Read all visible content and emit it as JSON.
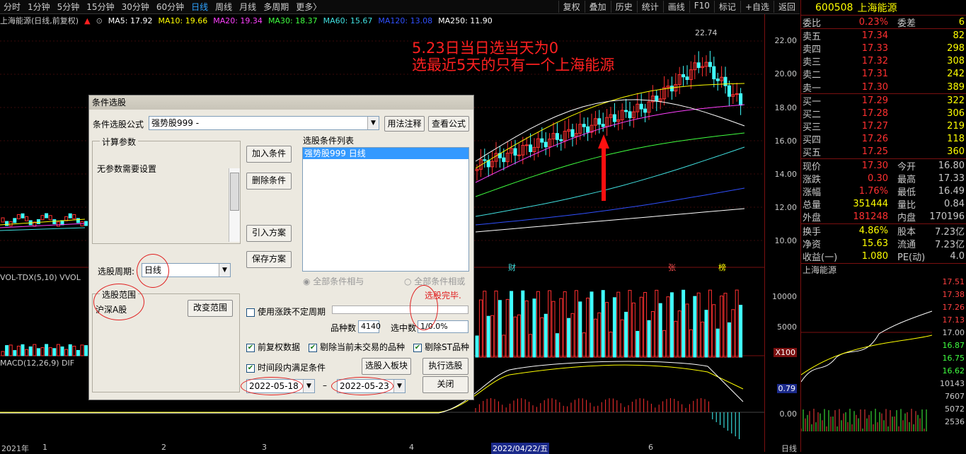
{
  "toolbar": {
    "tabs": [
      "分时",
      "1分钟",
      "5分钟",
      "15分钟",
      "30分钟",
      "60分钟",
      "日线",
      "周线",
      "月线",
      "多周期",
      "更多〉"
    ],
    "active_tab": "日线",
    "right_buttons": [
      "复权",
      "叠加",
      "历史",
      "统计",
      "画线",
      "F10",
      "标记",
      "+自选",
      "返回"
    ]
  },
  "ma_bar": {
    "title": "上海能源(日线,前复权)",
    "ma5": "MA5: 17.92",
    "ma10": "MA10: 19.66",
    "ma20": "MA20: 19.34",
    "ma30": "MA30: 18.37",
    "ma60": "MA60: 15.67",
    "ma120": "MA120: 13.08",
    "ma250": "MA250: 11.90"
  },
  "colors": {
    "ma5": "#ffffff",
    "ma10": "#ffff00",
    "ma20": "#ff40ff",
    "ma30": "#40ff40",
    "ma60": "#40e0e0",
    "ma120": "#3050ff",
    "ma250": "#ffffff",
    "up": "#ff3030",
    "down": "#40ffff"
  },
  "price_axis": [
    "22.00",
    "20.00",
    "18.00",
    "16.00",
    "14.00",
    "12.00",
    "10.00"
  ],
  "high_label": "22.74",
  "volume_axis": [
    "10000",
    "5000"
  ],
  "volume_unit": "X100",
  "macd_axis": [
    "0.79",
    "0.00"
  ],
  "panels": {
    "volume": "VOL-TDX(5,10) VVOL",
    "macd": "MACD(12,26,9) DIF"
  },
  "markers": {
    "cai": "财",
    "zhang": "张",
    "bang": "榜"
  },
  "date_axis": [
    "2021年",
    "1",
    "2",
    "3",
    "4",
    "2022/04/22/五",
    "6"
  ],
  "period_label": "日线",
  "annotation": {
    "line1": "5.23日当日选当天为0",
    "line2": "选最近5天的只有一个上海能源"
  },
  "quote": {
    "code": "600508",
    "name": "上海能源",
    "weibi_label": "委比",
    "weibi": "0.23%",
    "weicha_label": "委差",
    "weicha": "6",
    "asks": [
      {
        "label": "卖五",
        "price": "17.34",
        "vol": "82"
      },
      {
        "label": "卖四",
        "price": "17.33",
        "vol": "298"
      },
      {
        "label": "卖三",
        "price": "17.32",
        "vol": "308"
      },
      {
        "label": "卖二",
        "price": "17.31",
        "vol": "242"
      },
      {
        "label": "卖一",
        "price": "17.30",
        "vol": "389"
      }
    ],
    "bids": [
      {
        "label": "买一",
        "price": "17.29",
        "vol": "322"
      },
      {
        "label": "买二",
        "price": "17.28",
        "vol": "306"
      },
      {
        "label": "买三",
        "price": "17.27",
        "vol": "219"
      },
      {
        "label": "买四",
        "price": "17.26",
        "vol": "118"
      },
      {
        "label": "买五",
        "price": "17.25",
        "vol": "360"
      }
    ],
    "stats": [
      {
        "l1": "现价",
        "v1": "17.30",
        "l2": "今开",
        "v2": "16.80",
        "c1": "red",
        "c2": "red"
      },
      {
        "l1": "涨跌",
        "v1": "0.30",
        "l2": "最高",
        "v2": "17.33",
        "c1": "red",
        "c2": "red"
      },
      {
        "l1": "涨幅",
        "v1": "1.76%",
        "l2": "最低",
        "v2": "16.49",
        "c1": "red",
        "c2": "green"
      },
      {
        "l1": "总量",
        "v1": "351444",
        "l2": "量比",
        "v2": "0.84",
        "c1": "yellow",
        "c2": "yellow"
      },
      {
        "l1": "外盘",
        "v1": "181248",
        "l2": "内盘",
        "v2": "170196",
        "c1": "red",
        "c2": "green"
      }
    ],
    "stats2": [
      {
        "l1": "换手",
        "v1": "4.86%",
        "l2": "股本",
        "v2": "7.23亿"
      },
      {
        "l1": "净资",
        "v1": "15.63",
        "l2": "流通",
        "v2": "7.23亿"
      },
      {
        "l1": "收益(一)",
        "v1": "1.080",
        "l2": "PE(动)",
        "v2": "4.0"
      }
    ],
    "mini_title": "上海能源",
    "mini_axis": [
      "17.51",
      "17.38",
      "17.26",
      "17.13",
      "17.00",
      "16.87",
      "16.75",
      "16.62",
      "10143",
      "7607",
      "5072",
      "2536"
    ]
  },
  "dialog": {
    "title": "条件选股",
    "formula_label": "条件选股公式",
    "formula_value": "强势股999    -",
    "btn_usage": "用法注释",
    "btn_view": "查看公式",
    "params_group": "计算参数",
    "params_text": "无参数需要设置",
    "btn_add": "加入条件",
    "btn_delete": "删除条件",
    "btn_import": "引入方案",
    "btn_save": "保存方案",
    "list_label": "选股条件列表",
    "list_items": [
      "强势股999   日线"
    ],
    "period_label": "选股周期:",
    "period_value": "日线",
    "radio_and": "全部条件相与",
    "radio_or": "全部条件相或",
    "done_text": "选股完毕.",
    "range_group": "选股范围",
    "range_value": "沪深A股",
    "btn_change_range": "改变范围",
    "chk_uncertain": "使用涨跌不定周期",
    "count_label": "品种数",
    "count_value": "4140",
    "selected_label": "选中数",
    "selected_value": "1/0.0%",
    "chk_fq": "前复权数据",
    "chk_exclude_untraded": "剔除当前未交易的品种",
    "chk_exclude_st": "剔除ST品种",
    "chk_time_range": "时间段内满足条件",
    "btn_to_block": "选股入板块",
    "btn_execute": "执行选股",
    "btn_close": "关闭",
    "date_from": "2022-05-18",
    "date_to": "2022-05-23",
    "dash": "–"
  }
}
